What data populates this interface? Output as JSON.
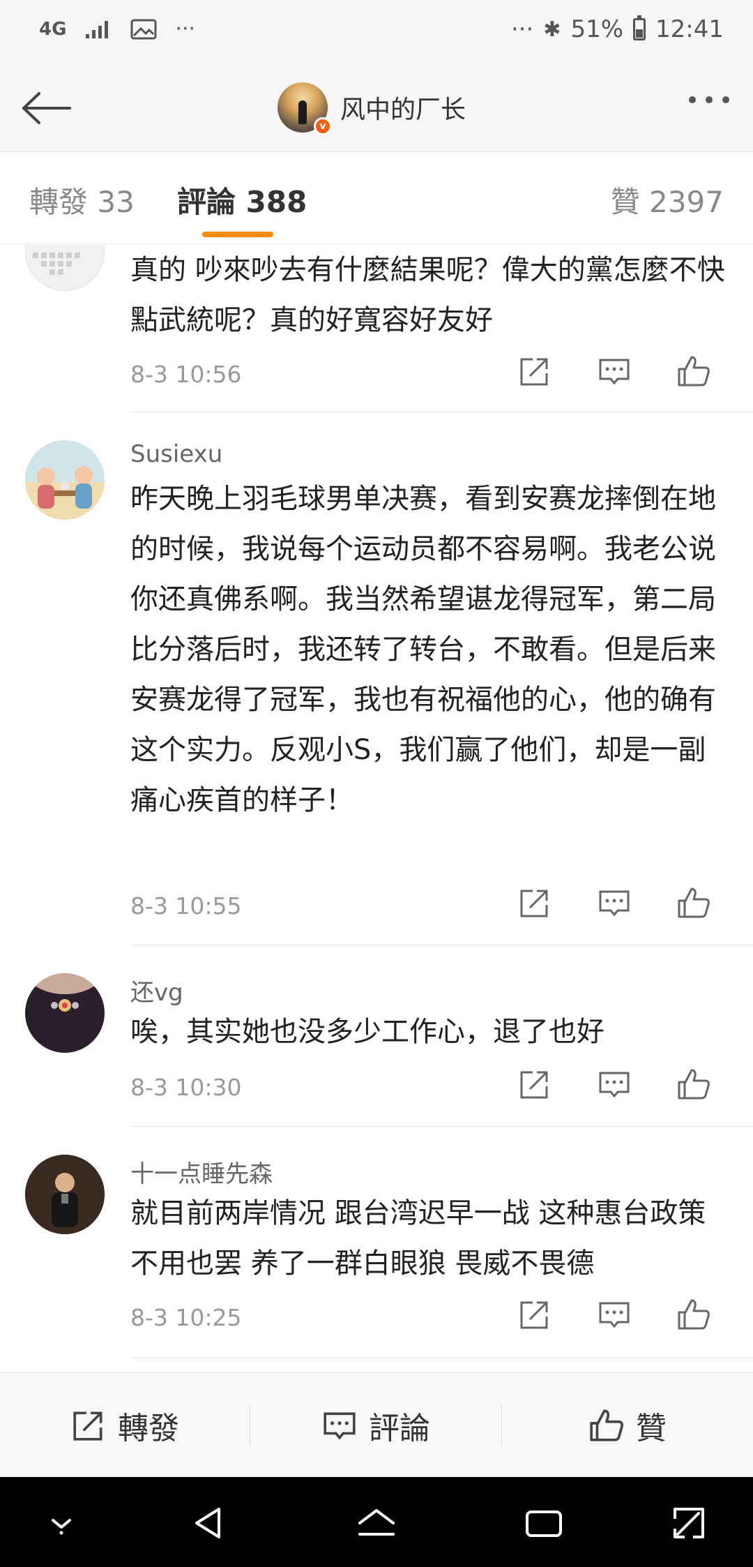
{
  "status_bar": {
    "network": "4G",
    "more": "···",
    "right_more": "···",
    "bluetooth": "✱",
    "battery": "51%",
    "time": "12:41"
  },
  "header": {
    "username": "风中的厂长",
    "verified_badge": "v"
  },
  "tabs": [
    {
      "label": "轉發 33"
    },
    {
      "label": "評論 388"
    },
    {
      "label": "贊 2397"
    }
  ],
  "comments": [
    {
      "name": "",
      "text": "真的 吵來吵去有什麼結果呢？偉大的黨怎麼不快點武統呢？真的好寬容好友好",
      "time": "8-3 10:56"
    },
    {
      "name": "Susiexu",
      "text": "昨天晚上羽毛球男单决赛，看到安赛龙摔倒在地的时候，我说每个运动员都不容易啊。我老公说你还真佛系啊。我当然希望谌龙得冠军，第二局比分落后时，我还转了转台，不敢看。但是后来安赛龙得了冠军，我也有祝福他的心，他的确有这个实力。反观小S，我们赢了他们，却是一副痛心疾首的样子！",
      "time": "8-3 10:55"
    },
    {
      "name": "还vg",
      "text": "唉，其实她也没多少工作心，退了也好",
      "time": "8-3 10:30"
    },
    {
      "name": "十一点睡先森",
      "text": "就目前两岸情况 跟台湾迟早一战 这种惠台政策不用也罢 养了一群白眼狼 畏威不畏德",
      "time": "8-3 10:25"
    }
  ],
  "toolbar": {
    "repost_label": "轉發",
    "comment_label": "評論",
    "like_label": "贊"
  },
  "colors": {
    "accent": "#fe8a05",
    "verified": "#f55e0a",
    "header_bg": "#f6f6f6",
    "nav_bg": "#000000"
  },
  "icons": [
    "signal-icon",
    "image-icon",
    "bluetooth-icon",
    "battery-icon",
    "back-arrow-icon",
    "more-icon",
    "repost-icon",
    "comment-icon",
    "like-icon",
    "nav-down-icon",
    "nav-back-icon",
    "nav-home-icon",
    "nav-recents-icon",
    "nav-rotate-icon"
  ]
}
